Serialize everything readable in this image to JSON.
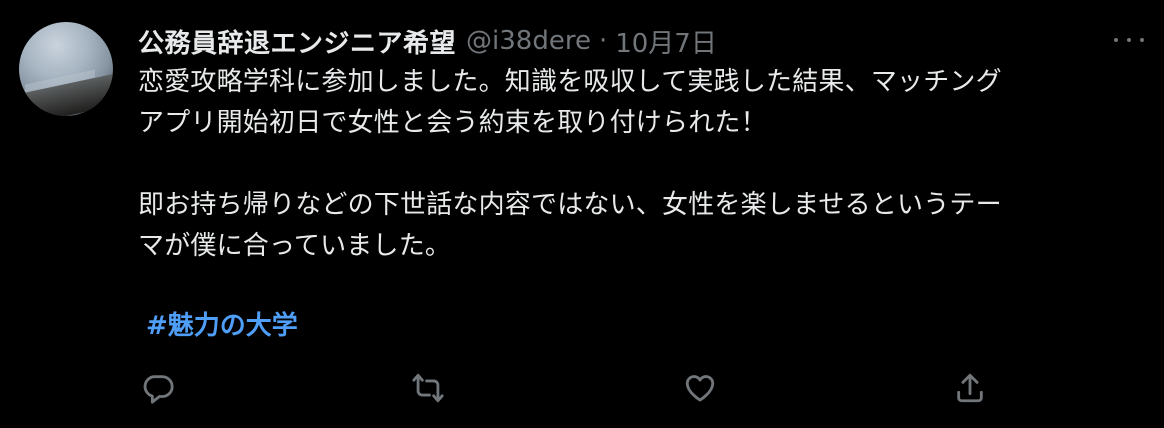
{
  "tweet": {
    "author": {
      "display_name": "公務員辞退エンジニア希望",
      "handle": "@i38dere",
      "separator": "·",
      "date": "10月7日"
    },
    "body_lines": [
      "恋愛攻略学科に参加しました。知識を吸収して実践した結果、マッチング",
      "アプリ開始初日で女性と会う約束を取り付けられた！",
      "",
      "即お持ち帰りなどの下世話な内容ではない、女性を楽しませるというテー",
      "マが僕に合っていました。"
    ],
    "hashtag": "#魅力の大学",
    "actions": [
      {
        "icon": "reply-icon"
      },
      {
        "icon": "retweet-icon"
      },
      {
        "icon": "like-icon"
      },
      {
        "icon": "share-icon"
      }
    ],
    "more_icon": "more-options-icon"
  },
  "colors": {
    "background": "#000000",
    "primary_text": "#e7e9ea",
    "secondary_text": "#71767b",
    "hashtag": "#4f9ef8"
  }
}
